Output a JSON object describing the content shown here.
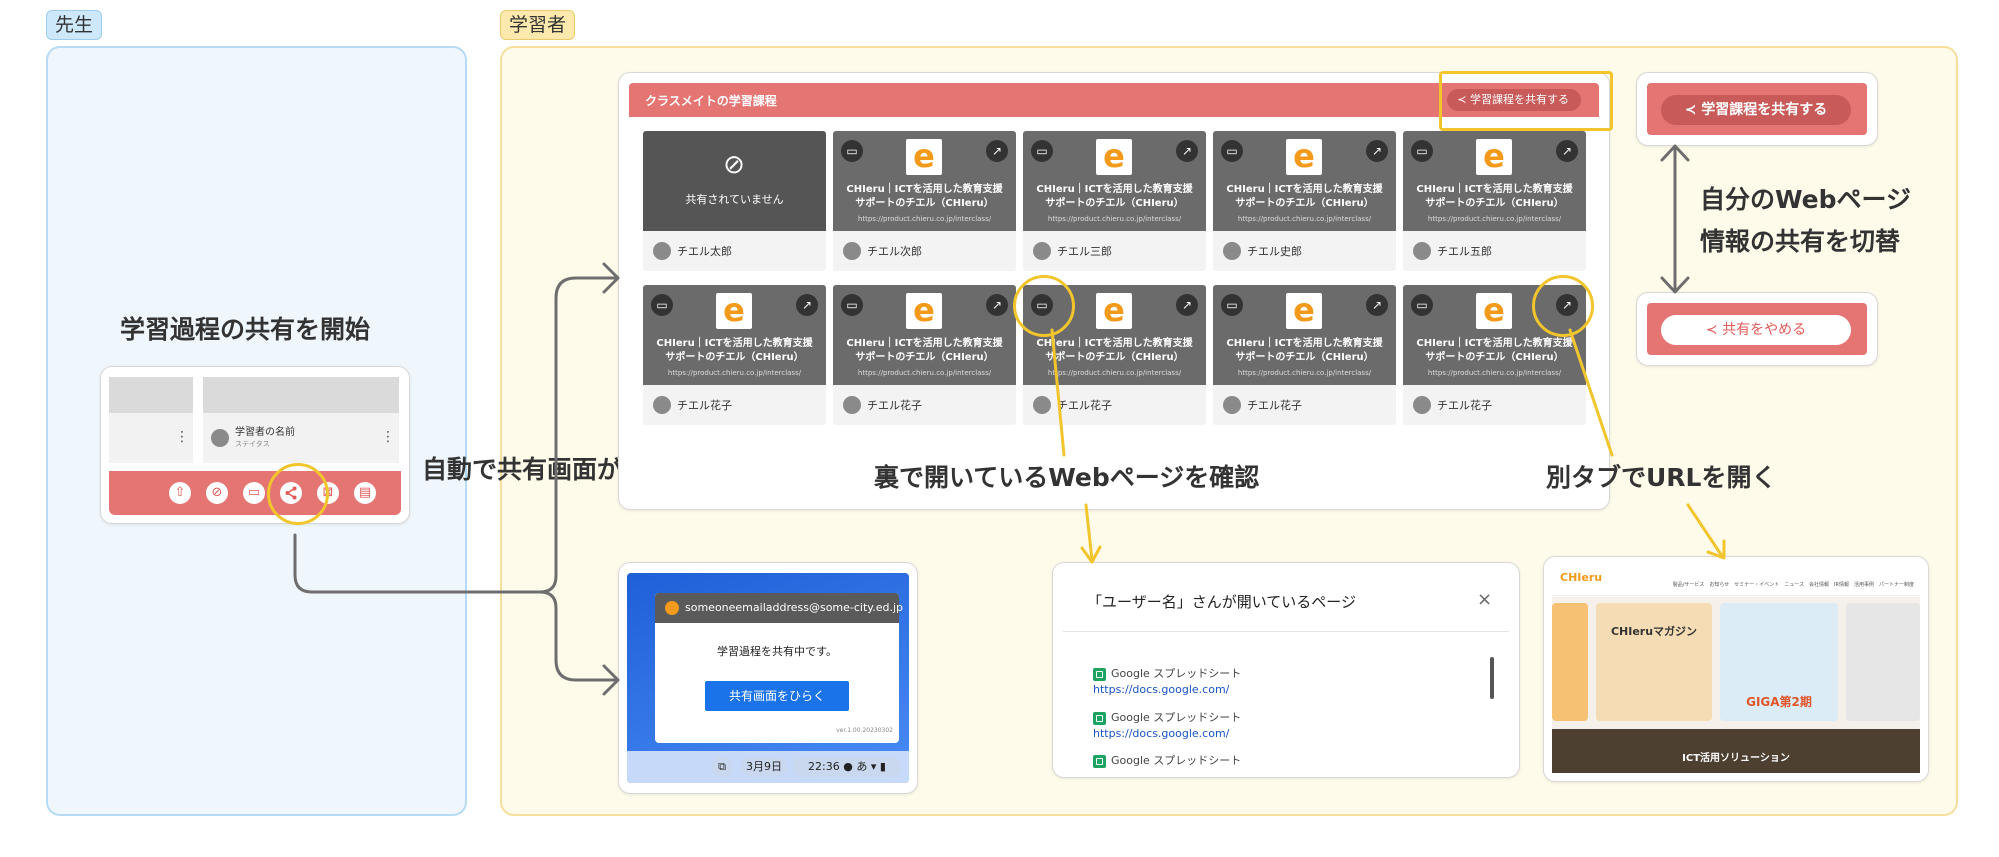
{
  "tags": {
    "teacher": "先生",
    "learner": "学習者"
  },
  "labels": {
    "start_share": "学習過程の共有を開始",
    "auto_open": "自動で共有画面が開く",
    "check_background": "裏で開いているWebページを確認",
    "open_new_tab": "別タブでURLを開く",
    "toggle_line1": "自分のWebページ",
    "toggle_line2": "情報の共有を切替"
  },
  "teacher_card": {
    "learner_name": "学習者の名前",
    "learner_status": "ステイタス",
    "menu_glyph": "⋮",
    "toolbar_icons": [
      "export-icon",
      "block-icon",
      "message-icon",
      "share-icon",
      "close-box-icon",
      "chat-icon"
    ]
  },
  "classmates_panel": {
    "title": "クラスメイトの学習課程",
    "share_button": "学習課程を共有する",
    "not_shared_text": "共有されていません",
    "page_title_line1": "CHIeru｜ICTを活用した教育支援",
    "page_title_line2": "サポートのチエル（CHIeru）",
    "page_url": "https://product.chieru.co.jp/interclass/",
    "logo_letter": "e",
    "tiles": [
      {
        "user": "チエル太郎",
        "shared": false
      },
      {
        "user": "チエル次郎",
        "shared": true
      },
      {
        "user": "チエル三郎",
        "shared": true
      },
      {
        "user": "チエル史郎",
        "shared": true
      },
      {
        "user": "チエル五郎",
        "shared": true
      },
      {
        "user": "チエル花子",
        "shared": true
      },
      {
        "user": "チエル花子",
        "shared": true
      },
      {
        "user": "チエル花子",
        "shared": true
      },
      {
        "user": "チエル花子",
        "shared": true
      },
      {
        "user": "チエル花子",
        "shared": true
      }
    ]
  },
  "toggle": {
    "share_on": "学習課程を共有する",
    "share_off": "共有をやめる"
  },
  "os_popup": {
    "email": "someoneemailaddress@some-city.ed.jp",
    "message": "学習過程を共有中です。",
    "button": "共有画面をひらく",
    "version": "ver.1.00.20230302",
    "date": "3月9日",
    "time": "22:36",
    "ime": "あ"
  },
  "background_pages": {
    "title": "「ユーザー名」さんが開いているページ",
    "close": "×",
    "items": [
      {
        "name": "Google スプレッドシート",
        "url": "https://docs.google.com/"
      },
      {
        "name": "Google スプレッドシート",
        "url": "https://docs.google.com/"
      },
      {
        "name": "Google スプレッドシート",
        "url": ""
      }
    ]
  },
  "website": {
    "logo": "CHIeru",
    "nav": "製品/サービス　お知らせ　セミナー・イベント　ニュース　会社情報　IR情報　活用事例　パートナー制度",
    "banner1_title": "CHIeruマガジン",
    "banner2_title": "GIGA第2期",
    "footer_small": "ICT活用ソリューション",
    "footer_title": "ICT活用ソリューション"
  },
  "colors": {
    "accent_red": "#e57573",
    "highlight_yellow": "#f2c52d",
    "teacher_bg": "#eff7fd",
    "learner_bg": "#fffbea",
    "chieru_orange": "#f39a1b"
  }
}
